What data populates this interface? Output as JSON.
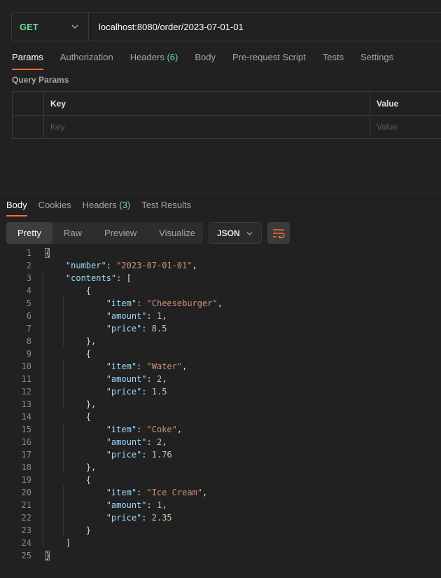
{
  "request": {
    "method": "GET",
    "url": "localhost:8080/order/2023-07-01-01",
    "tabs": [
      {
        "label": "Params"
      },
      {
        "label": "Authorization"
      },
      {
        "label": "Headers",
        "count": "(6)"
      },
      {
        "label": "Body"
      },
      {
        "label": "Pre-request Script"
      },
      {
        "label": "Tests"
      },
      {
        "label": "Settings"
      }
    ],
    "query_params_label": "Query Params",
    "table": {
      "headers": [
        "Key",
        "Value"
      ],
      "key_placeholder": "Key",
      "value_placeholder": "Value"
    }
  },
  "response": {
    "tabs": [
      {
        "label": "Body"
      },
      {
        "label": "Cookies"
      },
      {
        "label": "Headers",
        "count": "(3)"
      },
      {
        "label": "Test Results"
      }
    ],
    "view_modes": [
      "Pretty",
      "Raw",
      "Preview",
      "Visualize"
    ],
    "format": "JSON",
    "icons": {
      "wrap": "wrap-lines-icon",
      "chevron": "chevron-down-icon"
    },
    "lines": [
      {
        "n": "1",
        "text": "{"
      },
      {
        "n": "2",
        "text": "    \"number\": \"2023-07-01-01\","
      },
      {
        "n": "3",
        "text": "    \"contents\": ["
      },
      {
        "n": "4",
        "text": "        {"
      },
      {
        "n": "5",
        "text": "            \"item\": \"Cheeseburger\","
      },
      {
        "n": "6",
        "text": "            \"amount\": 1,"
      },
      {
        "n": "7",
        "text": "            \"price\": 8.5"
      },
      {
        "n": "8",
        "text": "        },"
      },
      {
        "n": "9",
        "text": "        {"
      },
      {
        "n": "10",
        "text": "            \"item\": \"Water\","
      },
      {
        "n": "11",
        "text": "            \"amount\": 2,"
      },
      {
        "n": "12",
        "text": "            \"price\": 1.5"
      },
      {
        "n": "13",
        "text": "        },"
      },
      {
        "n": "14",
        "text": "        {"
      },
      {
        "n": "15",
        "text": "            \"item\": \"Coke\","
      },
      {
        "n": "16",
        "text": "            \"amount\": 2,"
      },
      {
        "n": "17",
        "text": "            \"price\": 1.76"
      },
      {
        "n": "18",
        "text": "        },"
      },
      {
        "n": "19",
        "text": "        {"
      },
      {
        "n": "20",
        "text": "            \"item\": \"Ice Cream\","
      },
      {
        "n": "21",
        "text": "            \"amount\": 1,"
      },
      {
        "n": "22",
        "text": "            \"price\": 2.35"
      },
      {
        "n": "23",
        "text": "        }"
      },
      {
        "n": "24",
        "text": "    ]"
      },
      {
        "n": "25",
        "text": "}"
      }
    ]
  },
  "colors": {
    "background": "#212121",
    "accent": "#ff6c37",
    "method_get": "#6bdd9a",
    "json_key": "#9cdcfe",
    "json_string": "#ce9178",
    "json_number": "#b5cea8"
  }
}
